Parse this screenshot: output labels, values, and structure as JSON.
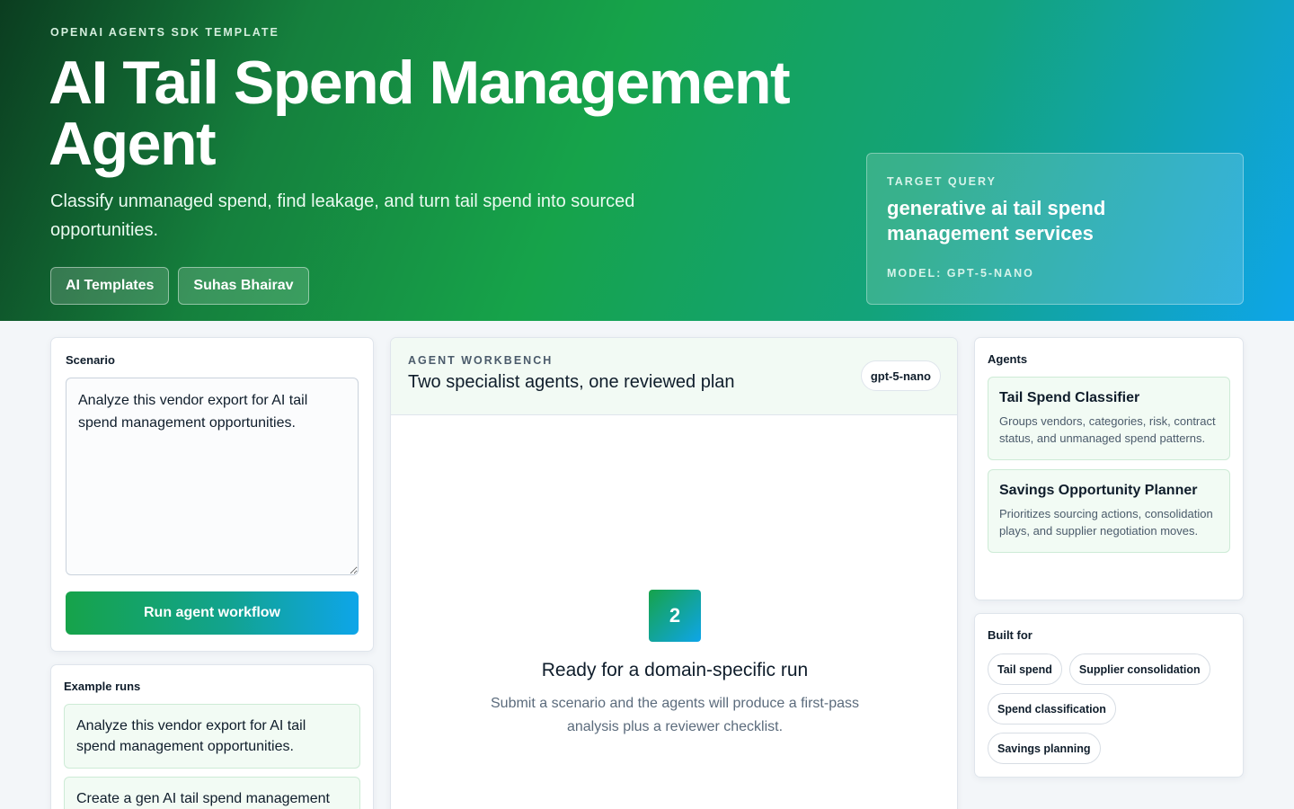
{
  "hero": {
    "eyebrow": "OPENAI AGENTS SDK TEMPLATE",
    "title": "AI Tail Spend Management Agent",
    "subtitle": "Classify unmanaged spend, find leakage, and turn tail spend into sourced opportunities.",
    "buttons": [
      "AI Templates",
      "Suhas Bhairav"
    ]
  },
  "target": {
    "label": "TARGET QUERY",
    "query": "generative ai tail spend management services",
    "model": "MODEL: GPT-5-NANO"
  },
  "scenario": {
    "title": "Scenario",
    "value": "Analyze this vendor export for AI tail spend management opportunities.",
    "run_label": "Run agent workflow"
  },
  "examples": {
    "title": "Example runs",
    "items": [
      "Analyze this vendor export for AI tail spend management opportunities.",
      "Create a gen AI tail spend management"
    ]
  },
  "workbench": {
    "eyebrow": "AGENT WORKBENCH",
    "title": "Two specialist agents, one reviewed plan",
    "model_pill": "gpt-5-nano",
    "step": "2",
    "ready_title": "Ready for a domain-specific run",
    "ready_desc": "Submit a scenario and the agents will produce a first-pass analysis plus a reviewer checklist."
  },
  "agents": {
    "title": "Agents",
    "items": [
      {
        "name": "Tail Spend Classifier",
        "desc": "Groups vendors, categories, risk, contract status, and unmanaged spend patterns."
      },
      {
        "name": "Savings Opportunity Planner",
        "desc": "Prioritizes sourcing actions, consolidation plays, and supplier negotiation moves."
      }
    ]
  },
  "built_for": {
    "title": "Built for",
    "tags": [
      "Tail spend",
      "Supplier consolidation",
      "Spend classification",
      "Savings planning"
    ]
  },
  "colors": {
    "brand_green": "#16a34a",
    "brand_blue": "#0ea5e9",
    "hero_dark": "#0b3d20"
  }
}
